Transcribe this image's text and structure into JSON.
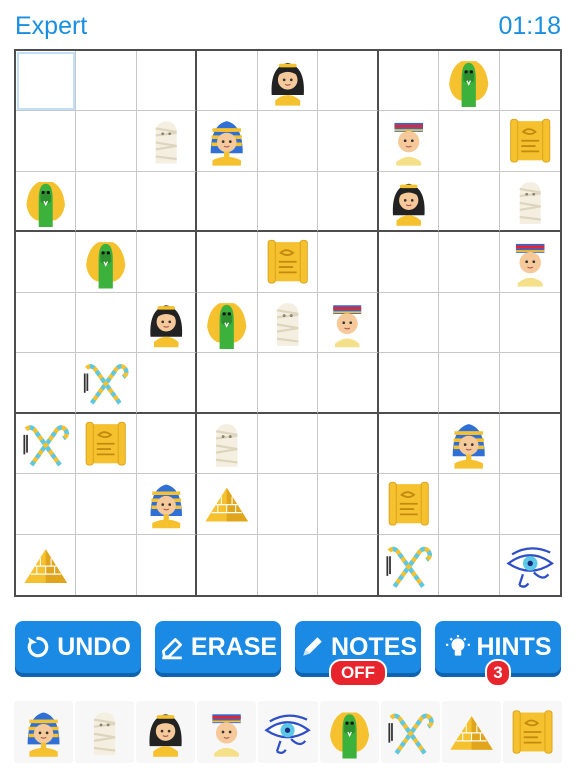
{
  "header": {
    "difficulty": "Expert",
    "timer": "01:18"
  },
  "board": {
    "rows": [
      [
        "",
        "",
        "",
        "",
        "pharaoh-woman",
        "",
        "",
        "cobra",
        ""
      ],
      [
        "",
        "",
        "mummy",
        "pharaoh-king",
        "",
        "",
        "pharaoh-boy",
        "",
        "scroll"
      ],
      [
        "cobra",
        "",
        "",
        "",
        "",
        "",
        "pharaoh-woman",
        "",
        "mummy"
      ],
      [
        "",
        "cobra",
        "",
        "",
        "scroll",
        "",
        "",
        "",
        "pharaoh-boy"
      ],
      [
        "",
        "",
        "pharaoh-woman",
        "cobra",
        "mummy",
        "pharaoh-boy",
        "",
        "",
        ""
      ],
      [
        "",
        "crook-flail",
        "",
        "",
        "",
        "",
        "",
        "",
        ""
      ],
      [
        "crook-flail",
        "scroll",
        "",
        "mummy",
        "",
        "",
        "",
        "pharaoh-king",
        ""
      ],
      [
        "",
        "",
        "pharaoh-king",
        "pyramid",
        "",
        "",
        "scroll",
        "",
        ""
      ],
      [
        "pyramid",
        "",
        "",
        "",
        "",
        "",
        "crook-flail",
        "",
        "eye-of-horus"
      ]
    ]
  },
  "controls": {
    "undo": {
      "label": "UNDO",
      "icon": "undo-icon"
    },
    "erase": {
      "label": "ERASE",
      "icon": "eraser-icon"
    },
    "notes": {
      "label": "NOTES",
      "icon": "pencil-icon",
      "badge": "OFF"
    },
    "hints": {
      "label": "HINTS",
      "icon": "lightbulb-icon",
      "badge": "3"
    }
  },
  "palette": [
    "pharaoh-king",
    "mummy",
    "pharaoh-woman",
    "pharaoh-boy",
    "eye-of-horus",
    "cobra",
    "crook-flail",
    "pyramid",
    "scroll"
  ],
  "colors": {
    "accent": "#1b8ae5",
    "badge": "#e8242c",
    "gold": "#f5c12e"
  }
}
